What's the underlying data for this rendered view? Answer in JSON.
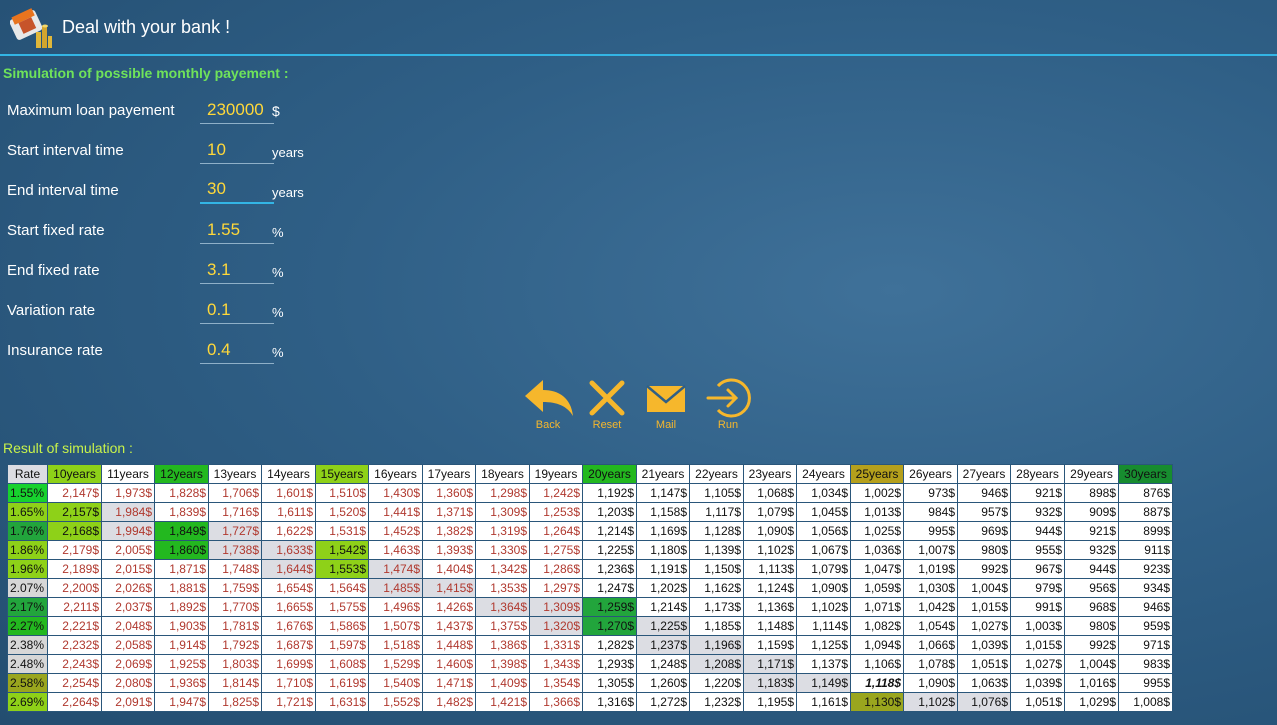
{
  "app": {
    "title": "Deal with your bank !"
  },
  "form": {
    "section_title": "Simulation of possible monthly payement :",
    "fields": [
      {
        "label": "Maximum loan payement",
        "value": "230000",
        "unit": "$"
      },
      {
        "label": "Start interval time",
        "value": "10",
        "unit": "years"
      },
      {
        "label": "End interval time",
        "value": "30",
        "unit": "years"
      },
      {
        "label": "Start fixed rate",
        "value": "1.55",
        "unit": "%"
      },
      {
        "label": "End fixed rate",
        "value": "3.1",
        "unit": "%"
      },
      {
        "label": "Variation rate",
        "value": "0.1",
        "unit": "%"
      },
      {
        "label": "Insurance rate",
        "value": "0.4",
        "unit": "%"
      }
    ]
  },
  "actions": {
    "back": "Back",
    "reset": "Reset",
    "mail": "Mail",
    "run": "Run"
  },
  "colors": {
    "accent": "#33b5e5",
    "input_text": "#ffd83a",
    "action_icons": "#f6b72c",
    "section_title": "#6fe35a",
    "result_title": "#c8f24a",
    "cell_text": "#b0392f"
  },
  "result": {
    "title": "Result of simulation :",
    "rate_header": "Rate",
    "years": [
      "10years",
      "11years",
      "12years",
      "13years",
      "14years",
      "15years",
      "16years",
      "17years",
      "18years",
      "19years",
      "20years",
      "21years",
      "22years",
      "23years",
      "24years",
      "25years",
      "26years",
      "27years",
      "28years",
      "29years",
      "30years"
    ],
    "rows": [
      {
        "rate": "1.55%",
        "cells": [
          "2,147$",
          "1,973$",
          "1,828$",
          "1,706$",
          "1,601$",
          "1,510$",
          "1,430$",
          "1,360$",
          "1,298$",
          "1,242$",
          "1,192$",
          "1,147$",
          "1,105$",
          "1,068$",
          "1,034$",
          "1,002$",
          "973$",
          "946$",
          "921$",
          "898$",
          "876$"
        ]
      },
      {
        "rate": "1.65%",
        "cells": [
          "2,157$",
          "1,984$",
          "1,839$",
          "1,716$",
          "1,611$",
          "1,520$",
          "1,441$",
          "1,371$",
          "1,309$",
          "1,253$",
          "1,203$",
          "1,158$",
          "1,117$",
          "1,079$",
          "1,045$",
          "1,013$",
          "984$",
          "957$",
          "932$",
          "909$",
          "887$"
        ]
      },
      {
        "rate": "1.76%",
        "cells": [
          "2,168$",
          "1,994$",
          "1,849$",
          "1,727$",
          "1,622$",
          "1,531$",
          "1,452$",
          "1,382$",
          "1,319$",
          "1,264$",
          "1,214$",
          "1,169$",
          "1,128$",
          "1,090$",
          "1,056$",
          "1,025$",
          "995$",
          "969$",
          "944$",
          "921$",
          "899$"
        ]
      },
      {
        "rate": "1.86%",
        "cells": [
          "2,179$",
          "2,005$",
          "1,860$",
          "1,738$",
          "1,633$",
          "1,542$",
          "1,463$",
          "1,393$",
          "1,330$",
          "1,275$",
          "1,225$",
          "1,180$",
          "1,139$",
          "1,102$",
          "1,067$",
          "1,036$",
          "1,007$",
          "980$",
          "955$",
          "932$",
          "911$"
        ]
      },
      {
        "rate": "1.96%",
        "cells": [
          "2,189$",
          "2,015$",
          "1,871$",
          "1,748$",
          "1,644$",
          "1,553$",
          "1,474$",
          "1,404$",
          "1,342$",
          "1,286$",
          "1,236$",
          "1,191$",
          "1,150$",
          "1,113$",
          "1,079$",
          "1,047$",
          "1,019$",
          "992$",
          "967$",
          "944$",
          "923$"
        ]
      },
      {
        "rate": "2.07%",
        "cells": [
          "2,200$",
          "2,026$",
          "1,881$",
          "1,759$",
          "1,654$",
          "1,564$",
          "1,485$",
          "1,415$",
          "1,353$",
          "1,297$",
          "1,247$",
          "1,202$",
          "1,162$",
          "1,124$",
          "1,090$",
          "1,059$",
          "1,030$",
          "1,004$",
          "979$",
          "956$",
          "934$"
        ]
      },
      {
        "rate": "2.17%",
        "cells": [
          "2,211$",
          "2,037$",
          "1,892$",
          "1,770$",
          "1,665$",
          "1,575$",
          "1,496$",
          "1,426$",
          "1,364$",
          "1,309$",
          "1,259$",
          "1,214$",
          "1,173$",
          "1,136$",
          "1,102$",
          "1,071$",
          "1,042$",
          "1,015$",
          "991$",
          "968$",
          "946$"
        ]
      },
      {
        "rate": "2.27%",
        "cells": [
          "2,221$",
          "2,048$",
          "1,903$",
          "1,781$",
          "1,676$",
          "1,586$",
          "1,507$",
          "1,437$",
          "1,375$",
          "1,320$",
          "1,270$",
          "1,225$",
          "1,185$",
          "1,148$",
          "1,114$",
          "1,082$",
          "1,054$",
          "1,027$",
          "1,003$",
          "980$",
          "959$"
        ]
      },
      {
        "rate": "2.38%",
        "cells": [
          "2,232$",
          "2,058$",
          "1,914$",
          "1,792$",
          "1,687$",
          "1,597$",
          "1,518$",
          "1,448$",
          "1,386$",
          "1,331$",
          "1,282$",
          "1,237$",
          "1,196$",
          "1,159$",
          "1,125$",
          "1,094$",
          "1,066$",
          "1,039$",
          "1,015$",
          "992$",
          "971$"
        ]
      },
      {
        "rate": "2.48%",
        "cells": [
          "2,243$",
          "2,069$",
          "1,925$",
          "1,803$",
          "1,699$",
          "1,608$",
          "1,529$",
          "1,460$",
          "1,398$",
          "1,343$",
          "1,293$",
          "1,248$",
          "1,208$",
          "1,171$",
          "1,137$",
          "1,106$",
          "1,078$",
          "1,051$",
          "1,027$",
          "1,004$",
          "983$"
        ]
      },
      {
        "rate": "2.58%",
        "cells": [
          "2,254$",
          "2,080$",
          "1,936$",
          "1,814$",
          "1,710$",
          "1,619$",
          "1,540$",
          "1,471$",
          "1,409$",
          "1,354$",
          "1,305$",
          "1,260$",
          "1,220$",
          "1,183$",
          "1,149$",
          "1,118$",
          "1,090$",
          "1,063$",
          "1,039$",
          "1,016$",
          "995$"
        ]
      },
      {
        "rate": "2.69%",
        "cells": [
          "2,264$",
          "2,091$",
          "1,947$",
          "1,825$",
          "1,721$",
          "1,631$",
          "1,552$",
          "1,482$",
          "1,421$",
          "1,366$",
          "1,316$",
          "1,272$",
          "1,232$",
          "1,195$",
          "1,161$",
          "1,130$",
          "1,102$",
          "1,076$",
          "1,051$",
          "1,029$",
          "1,008$"
        ]
      }
    ]
  }
}
